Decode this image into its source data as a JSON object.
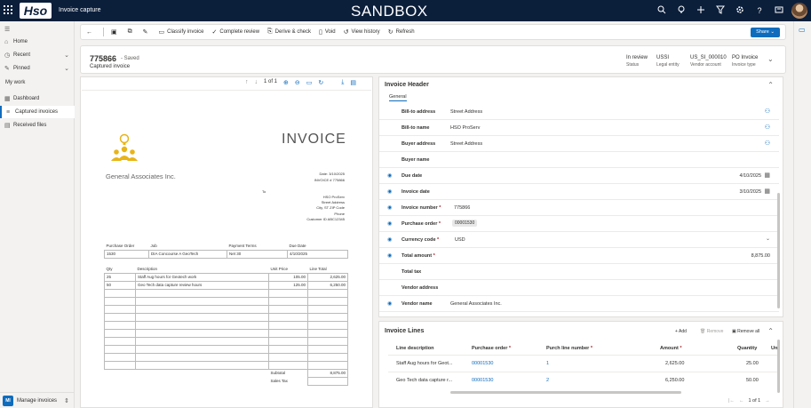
{
  "topbar": {
    "logo": "Hso",
    "app_title": "Invoice capture",
    "environment": "SANDBOX",
    "icons": [
      "search-icon",
      "lightbulb-icon",
      "plus-icon",
      "filter-icon",
      "settings-icon",
      "help-icon",
      "chat-icon"
    ]
  },
  "nav": {
    "home": "Home",
    "recent": "Recent",
    "pinned": "Pinned",
    "my_work": "My work",
    "dashboard": "Dashboard",
    "captured_invoices": "Captured invoices",
    "received_files": "Received files",
    "area_badge": "MI",
    "area": "Manage invoices"
  },
  "commands": {
    "classify": "Classify invoice",
    "complete": "Complete review",
    "derive": "Derive & check",
    "void": "Void",
    "history": "View history",
    "refresh": "Refresh",
    "share": "Share"
  },
  "record": {
    "id": "775866",
    "saved": "- Saved",
    "subtitle": "Captured invoice",
    "fields": [
      {
        "value": "In review",
        "label": "Status"
      },
      {
        "value": "USSI",
        "label": "Legal entity"
      },
      {
        "value": "US_SI_000010",
        "label": "Vendor account"
      },
      {
        "value": "PO Invoice",
        "label": "Invoice type"
      }
    ]
  },
  "viewer": {
    "page": "1 of 1"
  },
  "invoice_doc": {
    "title": "INVOICE",
    "company": "General Associates Inc.",
    "date_line": "Date: 3/10/2025",
    "invoice_line": "INVOICE # 775866",
    "to_label": "To",
    "to_lines": [
      "HSO ProServ",
      "Street Address",
      "City, ST ZIP Code",
      "Phone",
      "Customer ID ABC12345"
    ],
    "order_headers": [
      "Purchase Order",
      "Job",
      "Payment Terms",
      "Due Date"
    ],
    "order_values": [
      "1530",
      "DIA Concourse A GeoTech",
      "Net 30",
      "4/10/2025"
    ],
    "item_headers": [
      "Qty",
      "Description",
      "Unit Price",
      "Line Total"
    ],
    "items": [
      [
        "25",
        "Staff Aug hours for Geotech work",
        "105.00",
        "2,625.00"
      ],
      [
        "50",
        "Geo Tech data capture review hours",
        "125.00",
        "6,250.00"
      ]
    ],
    "subtotal_label": "Subtotal",
    "subtotal_value": "8,875.00",
    "sales_tax_label": "Sales Tax"
  },
  "header_form": {
    "section": "Invoice Header",
    "tab": "General",
    "bill_to_address_label": "Bill-to address",
    "bill_to_address": "Street Address",
    "bill_to_name_label": "Bill-to name",
    "bill_to_name": "HSO ProServ",
    "buyer_address_label": "Buyer address",
    "buyer_address": "Street Address",
    "buyer_name_label": "Buyer name",
    "due_date_label": "Due date",
    "due_date": "4/10/2025",
    "invoice_date_label": "Invoice date",
    "invoice_date": "3/10/2025",
    "invoice_number_label": "Invoice number",
    "invoice_number": "775866",
    "purchase_order_label": "Purchase order",
    "purchase_order": "00001530",
    "currency_label": "Currency code",
    "currency": "USD",
    "total_amount_label": "Total amount",
    "total_amount": "8,875.00",
    "total_tax_label": "Total tax",
    "vendor_address_label": "Vendor address",
    "vendor_name_label": "Vendor name",
    "vendor_name": "General Associates Inc.",
    "required_mark": "*"
  },
  "lines": {
    "section": "Invoice Lines",
    "add": "Add",
    "remove": "Remove",
    "remove_all": "Remove all",
    "headers": [
      "Line description",
      "Purchase order",
      "Purch line number",
      "Amount",
      "Quantity",
      "Un"
    ],
    "rows": [
      [
        "Staff Aug hours for Geot...",
        "00001530",
        "1",
        "2,625.00",
        "25.00"
      ],
      [
        "Geo Tech data capture r...",
        "00001530",
        "2",
        "6,250.00",
        "50.00"
      ]
    ],
    "pager": "1 of 1"
  }
}
